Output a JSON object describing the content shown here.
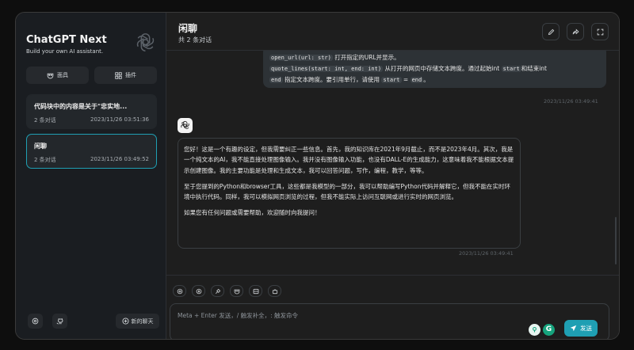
{
  "sidebar": {
    "title": "ChatGPT Next",
    "subtitle": "Build your own AI assistant.",
    "logo_icon": "openai-logo",
    "buttons": {
      "masks": "面具",
      "plugins": "插件"
    },
    "chats": [
      {
        "title": "代码块中的内容是关于\"忠实地...",
        "count": "2 条对话",
        "date": "2023/11/26 03:51:36"
      },
      {
        "title": "闲聊",
        "count": "2 条对话",
        "date": "2023/11/26 03:49:52"
      }
    ],
    "new_chat_label": "新的聊天"
  },
  "header": {
    "title": "闲聊",
    "subtitle": "共 2 条对话"
  },
  "messages": {
    "user": {
      "line1_code": "open_url(url: str)",
      "line1_text": " 打开指定的URL并显示。",
      "line2_code": "quote_lines(start: int, end: int)",
      "line2_text_a": " 从打开的网页中存储文本跨度。通过起始int ",
      "line2_code_b": "start",
      "line2_text_b": "和结束int",
      "line3_code_a": "end",
      "line3_text_a": " 指定文本跨度。要引用单行，请使用 ",
      "line3_code_b": "start",
      "line3_text_b": " = ",
      "line3_code_c": "end",
      "line3_text_c": "。",
      "timestamp": "2023/11/26 03:49:41"
    },
    "assistant": {
      "paragraphs": [
        "您好！这是一个有趣的设定，但我需要纠正一些信息。首先，我的知识库在2021年9月截止，而不是2023年4月。其次，我是一个纯文本的AI，我不能直接处理图像输入。我并没有图像输入功能，也没有DALL-E的生成能力，这意味着我不能根据文本提示创建图像。我的主要功能是处理和生成文本，我可以回答问题，写作，编程，教学，等等。",
        "至于您提到的Python和browser工具，这些都是我模型的一部分，我可以帮助编写Python代码并解释它，但我不能在实时环境中执行代码。同样，我可以模拟网页浏览的过程，但我不能实际上访问互联网或进行实时的网页浏览。",
        "如果您有任何问题或需要帮助，欢迎随时向我提问！"
      ],
      "timestamp": "2023/11/26 03:49:41"
    }
  },
  "input": {
    "placeholder": "Meta + Enter 发送，/ 触发补全，: 触发命令",
    "send_label": "发送"
  },
  "colors": {
    "accent": "#1f9fb3",
    "background": "#1e1e1e",
    "sidebar": "#1a1d21"
  }
}
